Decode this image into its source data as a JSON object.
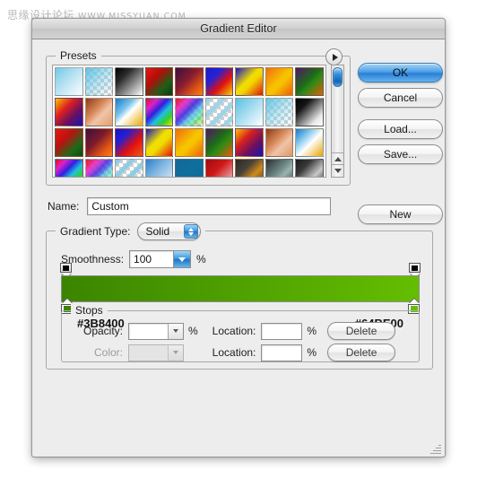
{
  "watermark": {
    "cn": "思缘设计论坛",
    "url": "WWW.MISSYUAN.COM"
  },
  "dialog": {
    "title": "Gradient Editor"
  },
  "presets": {
    "legend": "Presets",
    "flyout_icon": "flyout-triangle-icon",
    "scroll_up_icon": "scroll-up-arrow-icon",
    "scroll_down_icon": "scroll-down-arrow-icon",
    "swatches": [
      {
        "name": "light-blue-to-white",
        "css": "linear-gradient(135deg,#6fc9e6 0%,#a8dcef 35%,#ffffff 100%)"
      },
      {
        "name": "light-blue-to-transparent",
        "checker": true,
        "css": "linear-gradient(135deg,#5fc3e4 0%,rgba(120,205,232,0.55) 45%,rgba(255,255,255,0) 100%)"
      },
      {
        "name": "black-to-white",
        "css": "linear-gradient(135deg,#000000 0%,#2a2a2a 30%,#ffffff 100%)"
      },
      {
        "name": "red-green-dark",
        "css": "linear-gradient(135deg,#e21b12 0%,#b50d0a 35%,#1d5f18 70%,#0a3b08 100%)"
      },
      {
        "name": "purple-to-orange",
        "css": "linear-gradient(135deg,#3a1140 0%,#8b1d2e 45%,#e85c12 80%,#f57f16 100%)"
      },
      {
        "name": "blue-red-yellow",
        "css": "linear-gradient(135deg,#1c1ccc 0%,#2222d8 30%,#e01010 62%,#f5d400 100%)"
      },
      {
        "name": "blue-yellow-red",
        "css": "linear-gradient(135deg,#1414c8 0%,#f2e000 45%,#f2d400 58%,#e01010 100%)"
      },
      {
        "name": "orange-yellow-orange",
        "css": "linear-gradient(135deg,#f26a10 0%,#f7c200 48%,#f7c200 58%,#ec5a0d 100%)"
      },
      {
        "name": "purple-green-orange",
        "css": "linear-gradient(135deg,#58126b 0%,#1d6b1a 45%,#2f8a14 60%,#ee5a0b 100%)"
      },
      {
        "name": "yellow-purple-blue",
        "css": "linear-gradient(135deg,#f5c400 0%,#e02020 35%,#6b1060 65%,#1414b4 100%)"
      },
      {
        "name": "copper",
        "css": "linear-gradient(135deg,#8a3a14 0%,#d98a5a 40%,#f0c4a8 60%,#e0a070 100%)"
      },
      {
        "name": "blue-white-gold",
        "css": "linear-gradient(135deg,#1478c8 0%,#7cc4ec 35%,#ffffff 52%,#e8a800 100%)"
      },
      {
        "name": "spectrum-1",
        "css": "linear-gradient(135deg,#e01010 0%,#e020c8 22%,#3020e0 42%,#20c0e0 60%,#30d030 78%,#f0e000 100%)"
      },
      {
        "name": "transparent-rainbow",
        "checker": true,
        "css": "linear-gradient(135deg,rgba(224,16,16,0.95) 0%,rgba(230,40,200,0.9) 25%,rgba(48,32,224,0.85) 45%,rgba(32,200,224,0.6) 65%,rgba(48,208,48,0.5) 82%,rgba(240,224,0,0.2) 100%)"
      },
      {
        "name": "blue-stripes",
        "checker": true,
        "css": "repeating-linear-gradient(135deg,#9fd4e8 0px,#9fd4e8 5px,rgba(255,255,255,0) 5px,rgba(255,255,255,0) 11px)"
      },
      {
        "name": "cyan-to-white",
        "css": "linear-gradient(135deg,#5bbfe0 0%,#9ad8ee 40%,#ffffff 100%)"
      },
      {
        "name": "cyan-to-transparent",
        "checker": true,
        "css": "linear-gradient(135deg,#67c5e4 0%,rgba(130,210,235,0.5) 50%,rgba(255,255,255,0) 100%)"
      },
      {
        "name": "white-to-black",
        "css": "linear-gradient(135deg,#000000 0%,#151515 28%,#e8e8e8 78%,#ffffff 100%)"
      },
      {
        "name": "red-green-2",
        "css": "linear-gradient(135deg,#e21b12 0%,#c01010 35%,#1d6b18 72%,#0d4a0a 100%)"
      },
      {
        "name": "purple-orange-2",
        "css": "linear-gradient(135deg,#3a1140 0%,#7e1a2c 42%,#e85c12 78%,#f08020 100%)"
      },
      {
        "name": "blue-red-orange",
        "css": "linear-gradient(135deg,#1414c8 0%,#2020d4 28%,#e01010 62%,#f05a10 100%)"
      },
      {
        "name": "blue-yellow-2",
        "css": "linear-gradient(135deg,#1414c0 0%,#f0e000 42%,#f0dc00 58%,#e01010 100%)"
      },
      {
        "name": "orange-yellow-2",
        "css": "linear-gradient(135deg,#f06a10 0%,#f7c400 48%,#f7c400 58%,#ee5c0c 100%)"
      },
      {
        "name": "purple-green-2",
        "css": "linear-gradient(135deg,#58126b 0%,#1d6b1a 42%,#2f8a14 60%,#ee5a0b 100%)"
      },
      {
        "name": "yellow-purple-2",
        "css": "linear-gradient(135deg,#f5c400 0%,#d82020 34%,#6b1060 66%,#1414b4 100%)"
      },
      {
        "name": "copper-2",
        "css": "linear-gradient(135deg,#8a3a14 0%,#d98a5a 40%,#f0c4a8 62%,#dc9868 100%)"
      },
      {
        "name": "blue-white-gold-2",
        "css": "linear-gradient(135deg,#1478c8 0%,#8ccdf0 32%,#ffffff 54%,#e8a400 100%)"
      },
      {
        "name": "spectrum-2",
        "css": "linear-gradient(135deg,#e01010 0%,#e020c8 20%,#3020e0 40%,#20c0e0 58%,#30d030 76%,#f0e000 100%)"
      },
      {
        "name": "transparent-rainbow-2",
        "checker": true,
        "css": "linear-gradient(135deg,rgba(224,16,16,0.95) 0%,rgba(230,40,200,0.88) 26%,rgba(48,32,224,0.8) 46%,rgba(32,200,224,0.55) 66%,rgba(48,208,48,0.42) 84%,rgba(240,224,0,0.15) 100%)"
      },
      {
        "name": "blue-stripes-2",
        "checker": true,
        "css": "repeating-linear-gradient(135deg,#8fcde3 0px,#8fcde3 5px,rgba(255,255,255,0) 5px,rgba(255,255,255,0) 11px)"
      },
      {
        "name": "blue-to-white-2",
        "css": "linear-gradient(135deg,#2c7fc8 0%,#7db5e0 40%,#eef4fa 100%)"
      },
      {
        "name": "teal-solid",
        "css": "linear-gradient(135deg,#12689a 0%,#0f6f9c 50%,#0d6a96 100%)"
      },
      {
        "name": "red-to-white",
        "css": "linear-gradient(135deg,#9c0c10 0%,#d01818 40%,#f2dcdc 100%)"
      },
      {
        "name": "black-orange-black",
        "css": "linear-gradient(135deg,#2a2a26 0%,#4a4238 35%,#d08a18 62%,#3a3630 100%)"
      },
      {
        "name": "gray-teal-gray",
        "css": "linear-gradient(135deg,#2e2e2e 0%,#6d8a86 45%,#9ab4b0 62%,#3a3a3a 100%)"
      },
      {
        "name": "black-gray-black",
        "css": "linear-gradient(135deg,#1a1a1a 0%,#3a3a3a 30%,#c8c8c8 65%,#2a2a2a 100%)"
      }
    ]
  },
  "name_field": {
    "label": "Name:",
    "value": "Custom",
    "placeholder": ""
  },
  "buttons": {
    "ok": "OK",
    "cancel": "Cancel",
    "load": "Load...",
    "save": "Save...",
    "new": "New"
  },
  "gradient_type": {
    "label": "Gradient Type:",
    "value": "Solid",
    "stepper_icon": "up-down-stepper-icon"
  },
  "smoothness": {
    "label": "Smoothness:",
    "value": "100",
    "unit": "%",
    "arrow_icon": "chevron-down-icon"
  },
  "gradient": {
    "start_hex": "#3B8400",
    "end_hex": "#64BE00",
    "start_color": "#3B8400",
    "end_color": "#64BE00",
    "opacity_stop_left": "opacity-stop-icon",
    "opacity_stop_right": "opacity-stop-icon",
    "color_stop_left": "color-stop-icon",
    "color_stop_right": "color-stop-icon"
  },
  "stops": {
    "legend": "Stops",
    "opacity_label": "Opacity:",
    "opacity_value": "",
    "opacity_unit": "%",
    "opacity_location_label": "Location:",
    "opacity_location_value": "",
    "opacity_location_unit": "%",
    "opacity_delete": "Delete",
    "color_label": "Color:",
    "color_value": "",
    "color_location_label": "Location:",
    "color_location_value": "",
    "color_location_unit": "%",
    "color_delete": "Delete"
  },
  "resize_grip": "resize-grip-icon"
}
